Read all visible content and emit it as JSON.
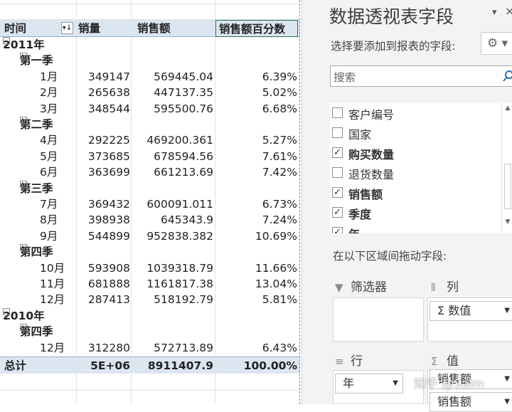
{
  "pivot": {
    "headers": [
      "时间",
      "销量",
      "销售额",
      "销售额百分数"
    ],
    "rows": [
      {
        "level": 0,
        "label": "2011年",
        "bold": true,
        "toggle": "⊟",
        "qty": "",
        "sales": "",
        "pct": ""
      },
      {
        "level": 1,
        "label": "第一季",
        "bold": true,
        "toggle": "⊟",
        "qty": "",
        "sales": "",
        "pct": ""
      },
      {
        "level": 2,
        "label": "1月",
        "qty": "349147",
        "sales": "569445.04",
        "pct": "6.39%"
      },
      {
        "level": 2,
        "label": "2月",
        "qty": "265638",
        "sales": "447137.35",
        "pct": "5.02%"
      },
      {
        "level": 2,
        "label": "3月",
        "qty": "348544",
        "sales": "595500.76",
        "pct": "6.68%"
      },
      {
        "level": 1,
        "label": "第二季",
        "bold": true,
        "toggle": "⊟",
        "qty": "",
        "sales": "",
        "pct": ""
      },
      {
        "level": 2,
        "label": "4月",
        "qty": "292225",
        "sales": "469200.361",
        "pct": "5.27%"
      },
      {
        "level": 2,
        "label": "5月",
        "qty": "373685",
        "sales": "678594.56",
        "pct": "7.61%"
      },
      {
        "level": 2,
        "label": "6月",
        "qty": "363699",
        "sales": "661213.69",
        "pct": "7.42%"
      },
      {
        "level": 1,
        "label": "第三季",
        "bold": true,
        "toggle": "⊟",
        "qty": "",
        "sales": "",
        "pct": ""
      },
      {
        "level": 2,
        "label": "7月",
        "qty": "369432",
        "sales": "600091.011",
        "pct": "6.73%"
      },
      {
        "level": 2,
        "label": "8月",
        "qty": "398938",
        "sales": "645343.9",
        "pct": "7.24%"
      },
      {
        "level": 2,
        "label": "9月",
        "qty": "544899",
        "sales": "952838.382",
        "pct": "10.69%"
      },
      {
        "level": 1,
        "label": "第四季",
        "bold": true,
        "toggle": "⊟",
        "qty": "",
        "sales": "",
        "pct": ""
      },
      {
        "level": 2,
        "label": "10月",
        "qty": "593908",
        "sales": "1039318.79",
        "pct": "11.66%"
      },
      {
        "level": 2,
        "label": "11月",
        "qty": "681888",
        "sales": "1161817.38",
        "pct": "13.04%"
      },
      {
        "level": 2,
        "label": "12月",
        "qty": "287413",
        "sales": "518192.79",
        "pct": "5.81%"
      },
      {
        "level": 0,
        "label": "2010年",
        "bold": true,
        "toggle": "⊟",
        "qty": "",
        "sales": "",
        "pct": ""
      },
      {
        "level": 1,
        "label": "第四季",
        "bold": true,
        "toggle": "⊟",
        "qty": "",
        "sales": "",
        "pct": ""
      },
      {
        "level": 2,
        "label": "12月",
        "qty": "312280",
        "sales": "572713.89",
        "pct": "6.43%"
      }
    ],
    "total": {
      "label": "总计",
      "qty": "5E+06",
      "sales": "8911407.9",
      "pct": "100.00%"
    }
  },
  "pane": {
    "title": "数据透视表字段",
    "subtitle": "选择要添加到报表的字段:",
    "search_placeholder": "搜索",
    "fields": [
      {
        "label": "客户编号",
        "checked": false
      },
      {
        "label": "国家",
        "checked": false
      },
      {
        "label": "购买数量",
        "checked": true
      },
      {
        "label": "退货数量",
        "checked": false
      },
      {
        "label": "销售额",
        "checked": true
      },
      {
        "label": "季度",
        "checked": true
      },
      {
        "label": "年",
        "checked": true
      }
    ],
    "drag_label": "在以下区域间拖动字段:",
    "areas": {
      "filter": {
        "label": "筛选器",
        "icon": "▼"
      },
      "columns": {
        "label": "列",
        "icon": "⦀",
        "items": [
          "Σ 数值"
        ]
      },
      "rows": {
        "label": "行",
        "icon": "≡",
        "items": [
          "年"
        ]
      },
      "values": {
        "label": "值",
        "icon": "Σ",
        "items": [
          "销售额",
          "销售额"
        ]
      }
    }
  },
  "watermark": "知乎 @Salm",
  "colors": {
    "header_fill": "#dce6f1",
    "selection": "#217346",
    "marching_ants": "#4a90d9"
  }
}
